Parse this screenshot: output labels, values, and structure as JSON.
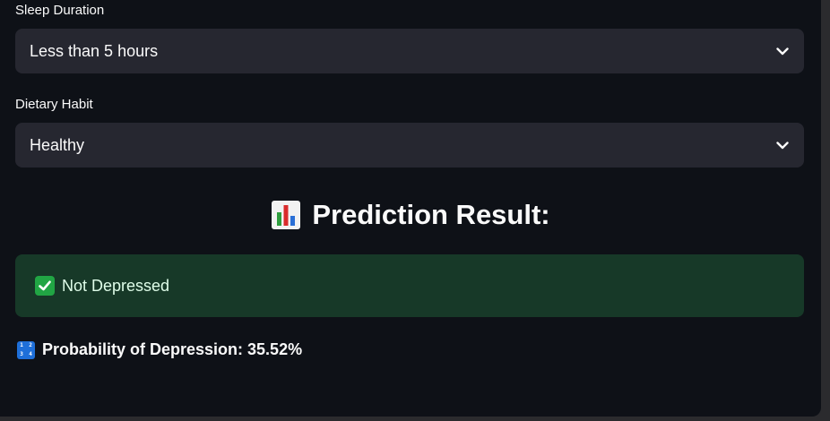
{
  "form": {
    "sleep": {
      "label": "Sleep Duration",
      "value": "Less than 5 hours"
    },
    "diet": {
      "label": "Dietary Habit",
      "value": "Healthy"
    }
  },
  "result": {
    "heading": "Prediction Result:",
    "heading_icon": "bar-chart-emoji-icon",
    "status_icon": "check-mark-emoji-icon",
    "status_text": "Not Depressed",
    "probability_icon": "numbers-emoji-icon",
    "probability_text": "Probability of Depression: 35.52%"
  },
  "colors": {
    "background": "#0e1117",
    "select_bg": "#262730",
    "success_bg": "#173928",
    "success_text": "#dffde9"
  }
}
